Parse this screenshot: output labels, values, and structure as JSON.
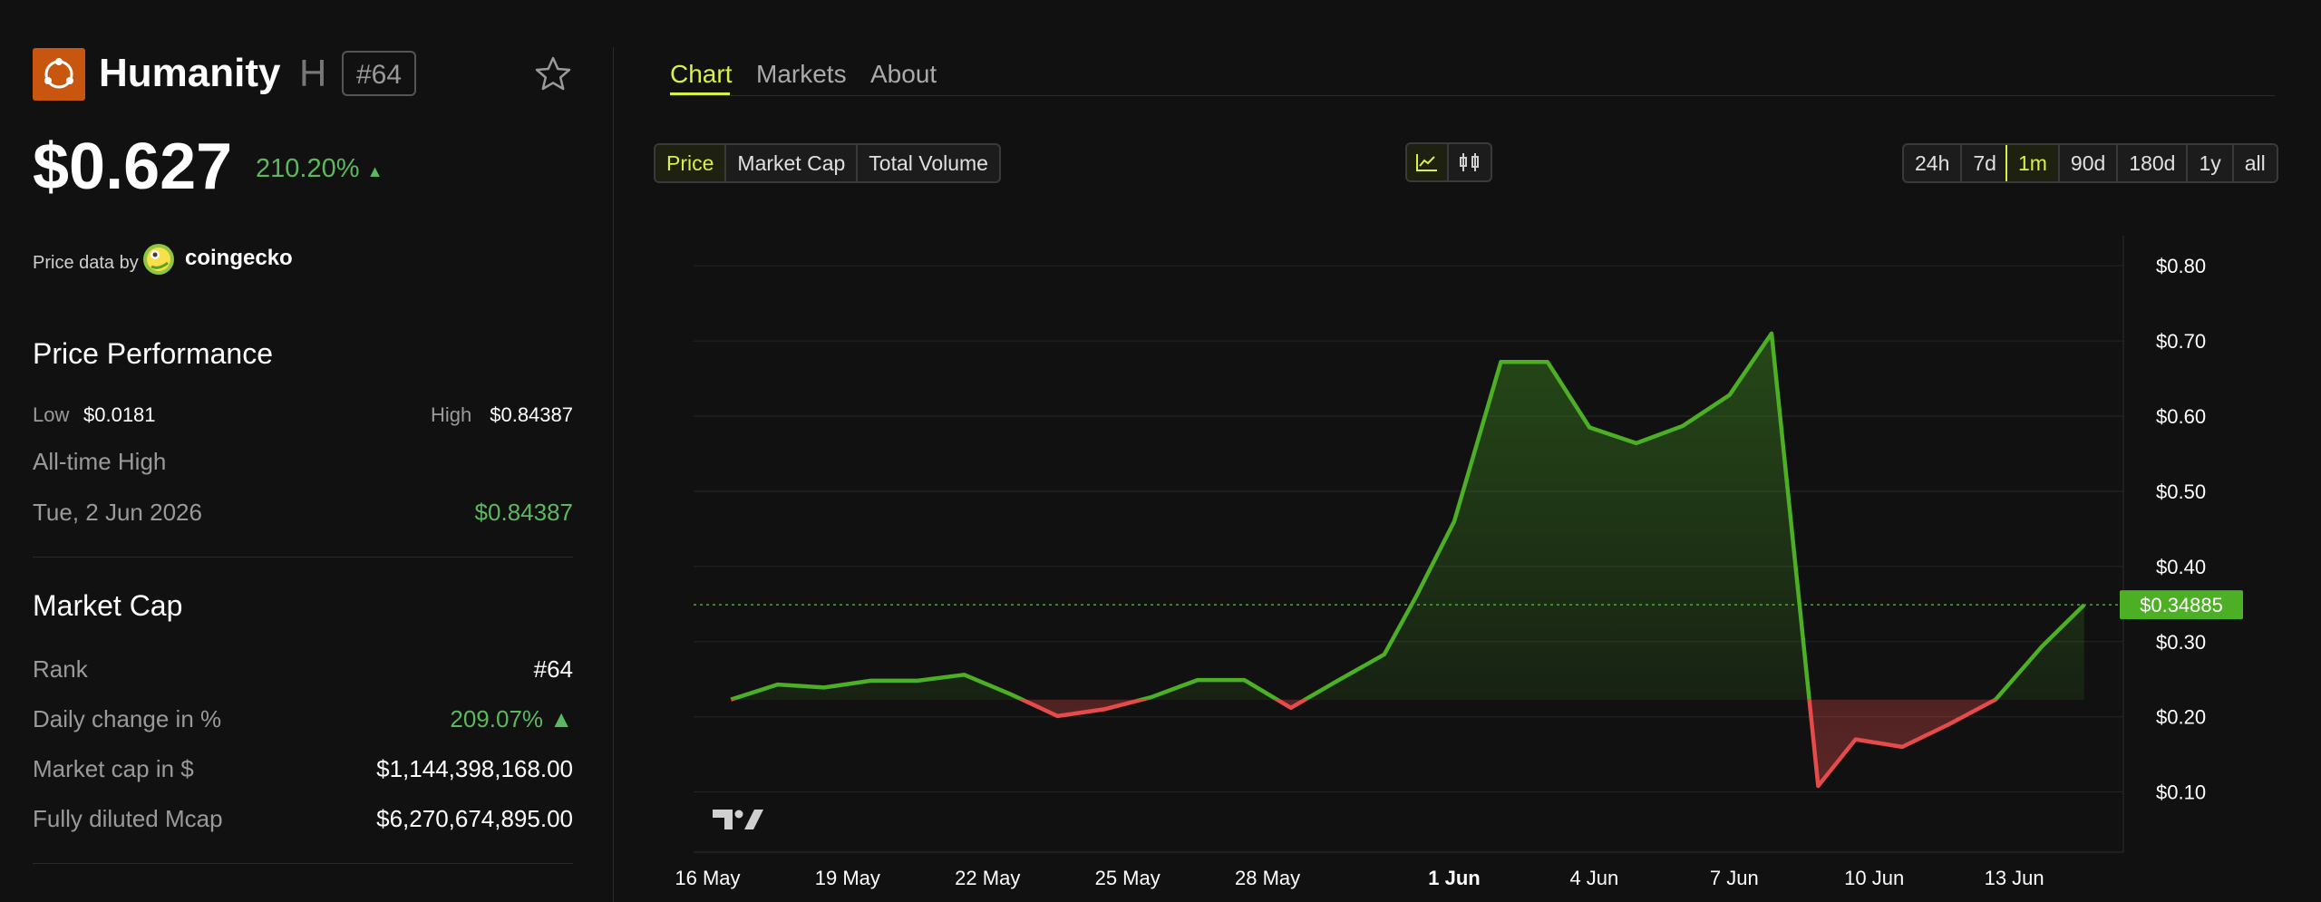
{
  "coin": {
    "name": "Humanity",
    "symbol": "H",
    "rank_badge": "#64",
    "price": "$0.627",
    "change": "210.20%",
    "change_arrow": "▲",
    "brand_color": "#c8560e"
  },
  "price_data": {
    "label": "Price data by",
    "provider": "coingecko"
  },
  "performance": {
    "title": "Price Performance",
    "low_label": "Low",
    "low_value": "$0.0181",
    "high_label": "High",
    "high_value": "$0.84387",
    "ath_label": "All-time High",
    "ath_date": "Tue, 2 Jun 2026",
    "ath_value": "$0.84387"
  },
  "market_cap": {
    "title": "Market Cap",
    "rows": [
      {
        "label": "Rank",
        "value": "#64"
      },
      {
        "label": "Daily change in %",
        "value": "209.07% ▲"
      },
      {
        "label": "Market cap in $",
        "value": "$1,144,398,168.00"
      },
      {
        "label": "Fully diluted Mcap",
        "value": "$6,270,674,895.00"
      }
    ]
  },
  "tabs": [
    "Chart",
    "Markets",
    "About"
  ],
  "metric_buttons": [
    "Price",
    "Market Cap",
    "Total Volume"
  ],
  "chart_type_buttons": [
    "line-chart-icon",
    "candlestick-icon"
  ],
  "range_buttons": [
    "24h",
    "7d",
    "1m",
    "90d",
    "180d",
    "1y",
    "all"
  ],
  "active_range": "1m",
  "chart_data": {
    "type": "line",
    "title": "",
    "xlabel": "",
    "ylabel": "",
    "ylim": [
      0.02,
      0.84
    ],
    "y_ticks": [
      "$0.10",
      "$0.20",
      "$0.30",
      "$0.40",
      "$0.50",
      "$0.60",
      "$0.70",
      "$0.80"
    ],
    "y_tick_values": [
      0.1,
      0.2,
      0.3,
      0.4,
      0.5,
      0.6,
      0.7,
      0.8
    ],
    "x_ticks": [
      "16 May",
      "19 May",
      "22 May",
      "25 May",
      "28 May",
      "1 Jun",
      "4 Jun",
      "7 Jun",
      "10 Jun",
      "13 Jun"
    ],
    "x_tick_days": [
      0,
      3,
      6,
      9,
      12,
      16,
      19,
      22,
      25,
      28
    ],
    "baseline": 0.223,
    "current_value_label": "$0.34885",
    "current_value": 0.349,
    "up_color": "#4caf24",
    "down_color": "#e54b4b",
    "series": [
      {
        "values": [
          [
            0.5,
            0.223
          ],
          [
            1.5,
            0.243
          ],
          [
            2.5,
            0.239
          ],
          [
            3.5,
            0.248
          ],
          [
            4.5,
            0.248
          ],
          [
            5.5,
            0.256
          ],
          [
            6.5,
            0.23
          ],
          [
            7.5,
            0.201
          ],
          [
            8.5,
            0.21
          ],
          [
            9.5,
            0.226
          ],
          [
            10.5,
            0.249
          ],
          [
            11.5,
            0.249
          ],
          [
            12.5,
            0.212
          ],
          [
            13.5,
            0.248
          ],
          [
            14.5,
            0.283
          ],
          [
            15.2,
            0.362
          ],
          [
            16.0,
            0.46
          ],
          [
            17.0,
            0.672
          ],
          [
            18.0,
            0.672
          ],
          [
            18.9,
            0.585
          ],
          [
            19.9,
            0.564
          ],
          [
            20.9,
            0.587
          ],
          [
            21.9,
            0.628
          ],
          [
            22.8,
            0.71
          ],
          [
            23.8,
            0.108
          ],
          [
            24.6,
            0.17
          ],
          [
            25.6,
            0.16
          ],
          [
            26.6,
            0.19
          ],
          [
            27.6,
            0.223
          ],
          [
            28.6,
            0.294
          ],
          [
            29.5,
            0.349
          ]
        ]
      }
    ]
  }
}
